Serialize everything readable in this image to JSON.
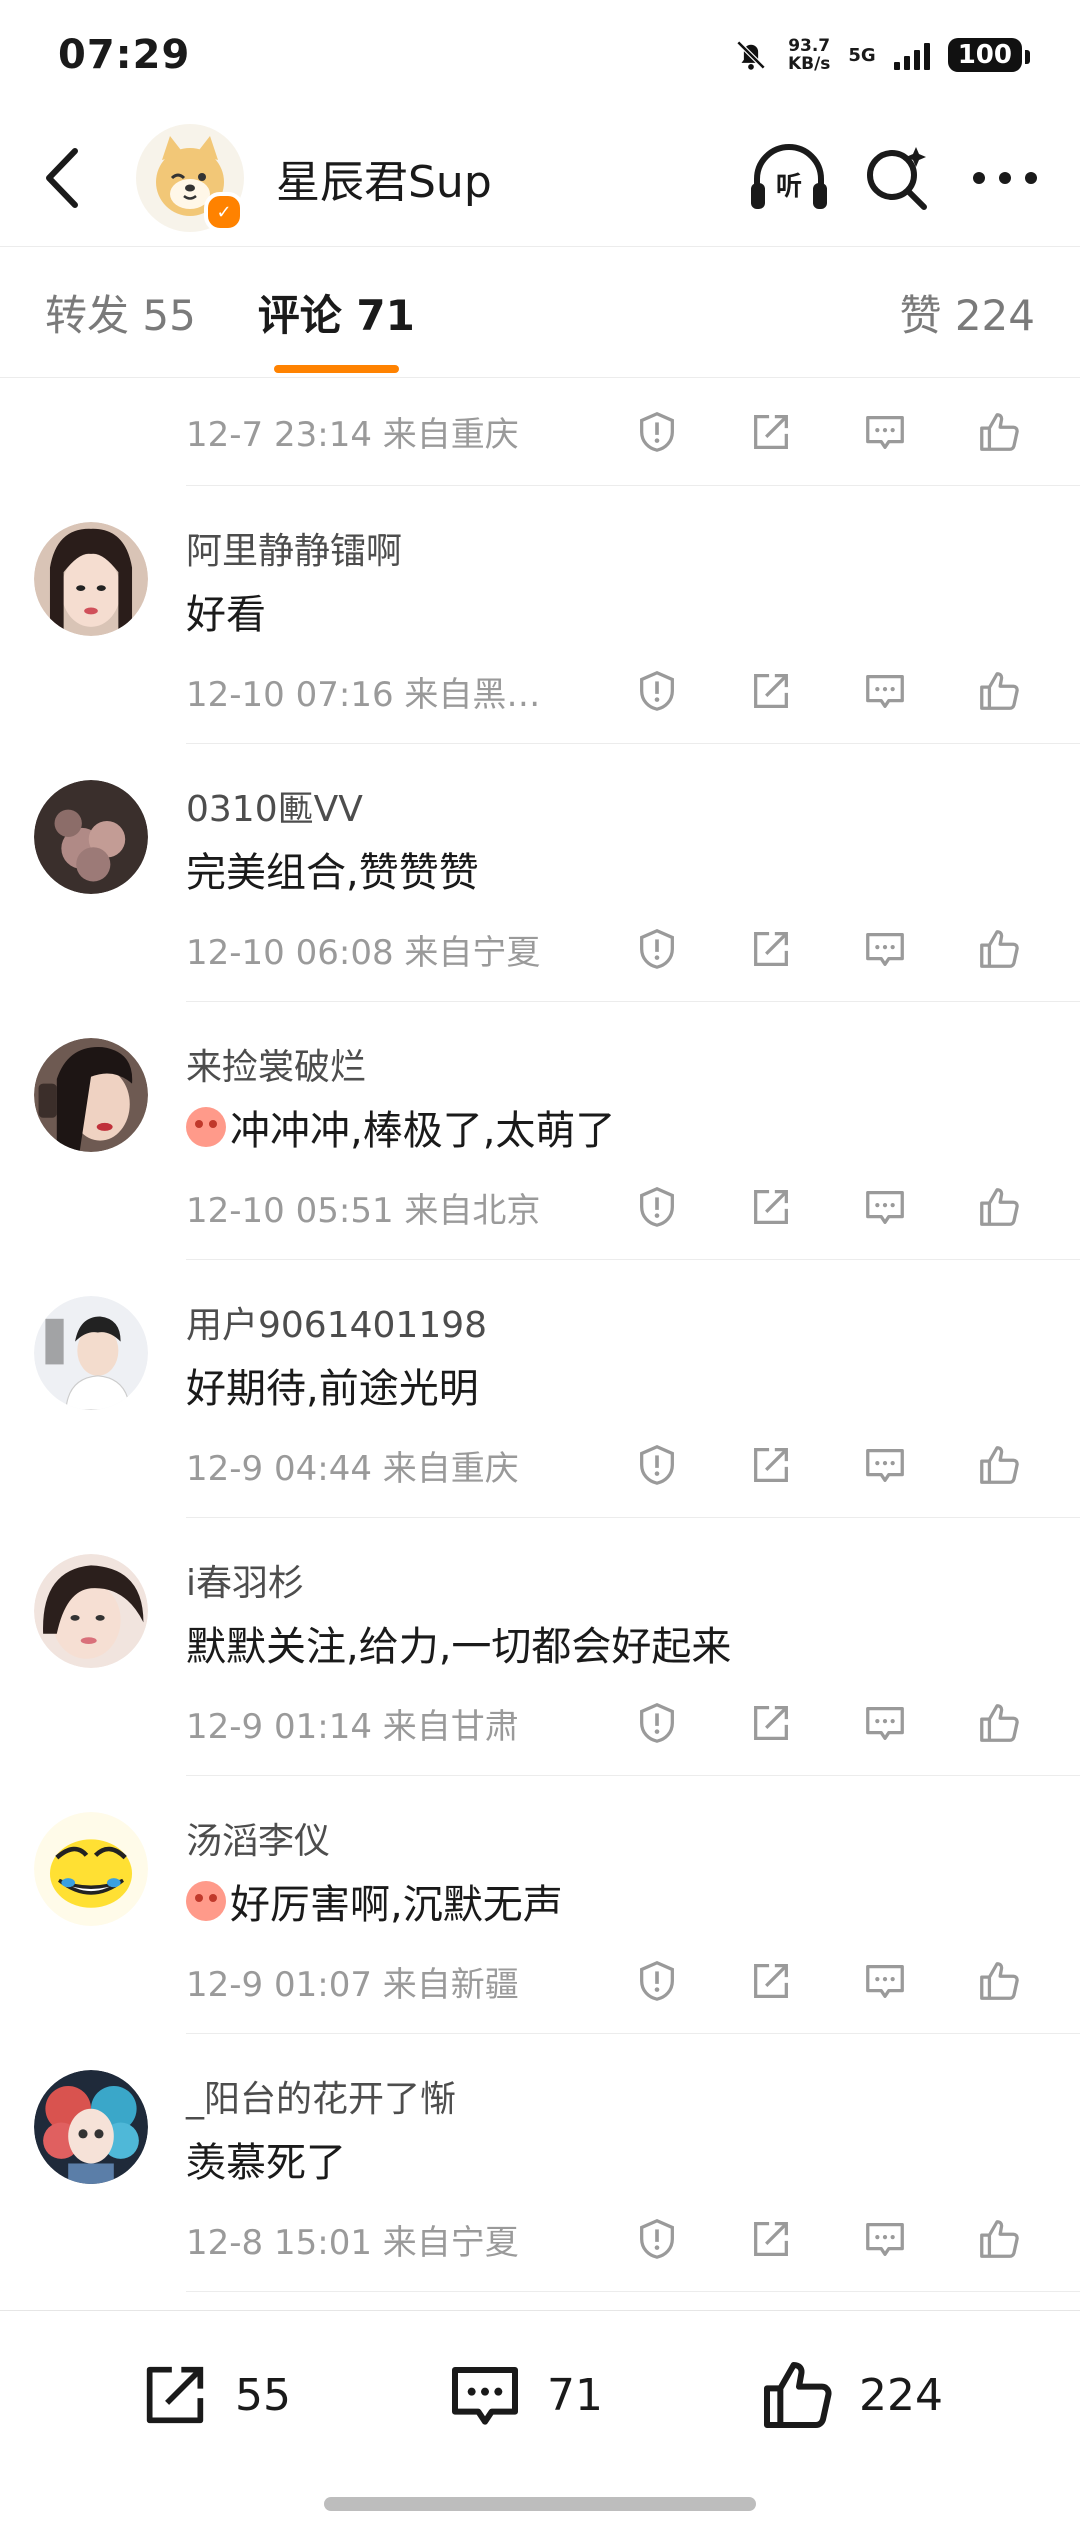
{
  "status": {
    "time": "07:29",
    "speed_value": "93.7",
    "speed_unit": "KB/s",
    "network": "5G",
    "battery": "100"
  },
  "header": {
    "title": "星辰君Sup",
    "listen_label": "听"
  },
  "tabs": {
    "repost": "转发 55",
    "comment": "评论 71",
    "like": "赞 224"
  },
  "top_row": {
    "meta": "12-7 23:14  来自重庆"
  },
  "comments": [
    {
      "name": "阿里静静镭啊",
      "text": "好看",
      "emoji": false,
      "meta": "12-10 07:16  来自黑…"
    },
    {
      "name": "0310匭VV",
      "text": "完美组合,赞赞赞",
      "emoji": false,
      "meta": "12-10 06:08  来自宁夏"
    },
    {
      "name": "来捡裳破烂",
      "text": "冲冲冲,棒极了,太萌了",
      "emoji": true,
      "meta": "12-10 05:51  来自北京"
    },
    {
      "name": "用户9061401198",
      "text": "好期待,前途光明",
      "emoji": false,
      "meta": "12-9 04:44  来自重庆"
    },
    {
      "name": "i春羽杉",
      "text": "默默关注,给力,一切都会好起来",
      "emoji": false,
      "meta": "12-9 01:14  来自甘肃"
    },
    {
      "name": "汤滔李仪",
      "text": "好厉害啊,沉默无声",
      "emoji": true,
      "meta": "12-9 01:07  来自新疆"
    },
    {
      "name": "_阳台的花开了惭",
      "text": "羡慕死了",
      "emoji": false,
      "meta": "12-8 15:01  来自宁夏"
    }
  ],
  "bottom": {
    "repost_count": "55",
    "comment_count": "71",
    "like_count": "224"
  },
  "colors": {
    "accent": "#ff8200",
    "meta_text": "#9a9a9a",
    "divider": "#ececec"
  }
}
